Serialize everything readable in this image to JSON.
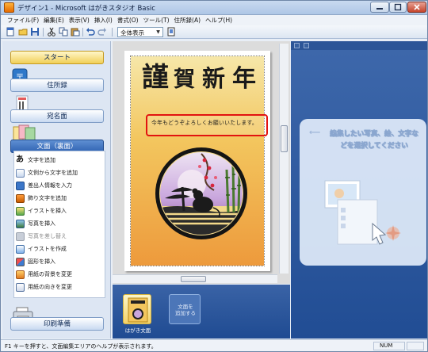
{
  "window": {
    "title": "デザイン1 - Microsoft はがきスタジオ Basic",
    "buttons": [
      "minimize-button",
      "maximize-button",
      "close-button"
    ]
  },
  "menu": [
    "ファイル(F)",
    "編集(E)",
    "表示(V)",
    "挿入(I)",
    "書式(O)",
    "ツール(T)",
    "住所録(A)",
    "ヘルプ(H)"
  ],
  "toolbar": {
    "zoom_value": "全体表示",
    "icons": [
      "new-icon",
      "open-icon",
      "save-icon",
      "cut-icon",
      "copy-icon",
      "paste-icon",
      "undo-icon",
      "redo-icon",
      "zoom-page-icon"
    ]
  },
  "sidebar": {
    "start": "スタート",
    "address_book": "住所録",
    "recipient_side": "宛名面",
    "front_side": "文面（裏面）",
    "tasks": [
      {
        "label": "文字を追加",
        "icon": "text-add-icon",
        "enabled": true
      },
      {
        "label": "文例から文字を追加",
        "icon": "template-text-icon",
        "enabled": true
      },
      {
        "label": "差出人情報を入力",
        "icon": "sender-icon",
        "enabled": true
      },
      {
        "label": "飾り文字を追加",
        "icon": "decorative-text-icon",
        "enabled": true
      },
      {
        "label": "イラストを挿入",
        "icon": "illustration-icon",
        "enabled": true
      },
      {
        "label": "写真を挿入",
        "icon": "photo-icon",
        "enabled": true
      },
      {
        "label": "写真を差し替え",
        "icon": "photo-replace-icon",
        "enabled": false
      },
      {
        "label": "イラストを作成",
        "icon": "illustration-create-icon",
        "enabled": true
      },
      {
        "label": "図形を挿入",
        "icon": "shape-icon",
        "enabled": true
      },
      {
        "label": "用紙の背景を変更",
        "icon": "background-icon",
        "enabled": true
      },
      {
        "label": "用紙の向きを変更",
        "icon": "orientation-icon",
        "enabled": true
      }
    ],
    "print": "印刷準備"
  },
  "canvas": {
    "headline_chars": [
      "謹",
      "賀",
      "新",
      "年"
    ],
    "message": "今年もどうぞよろしくお願いいたします。"
  },
  "thumbstrip": {
    "card_label": "はがき文面",
    "add_label": "文面を\n追加する"
  },
  "right_panel": {
    "hint": "編集したい写真、絵、文字などを選択してください"
  },
  "status": {
    "help_text": "F1 キーを押すと、文面編集エリアのヘルプが表示されます。",
    "num": "NUM"
  },
  "colors": {
    "accent_blue": "#2f62b3",
    "selection_red": "#e2130f",
    "card_gold": "#f3c65e"
  }
}
